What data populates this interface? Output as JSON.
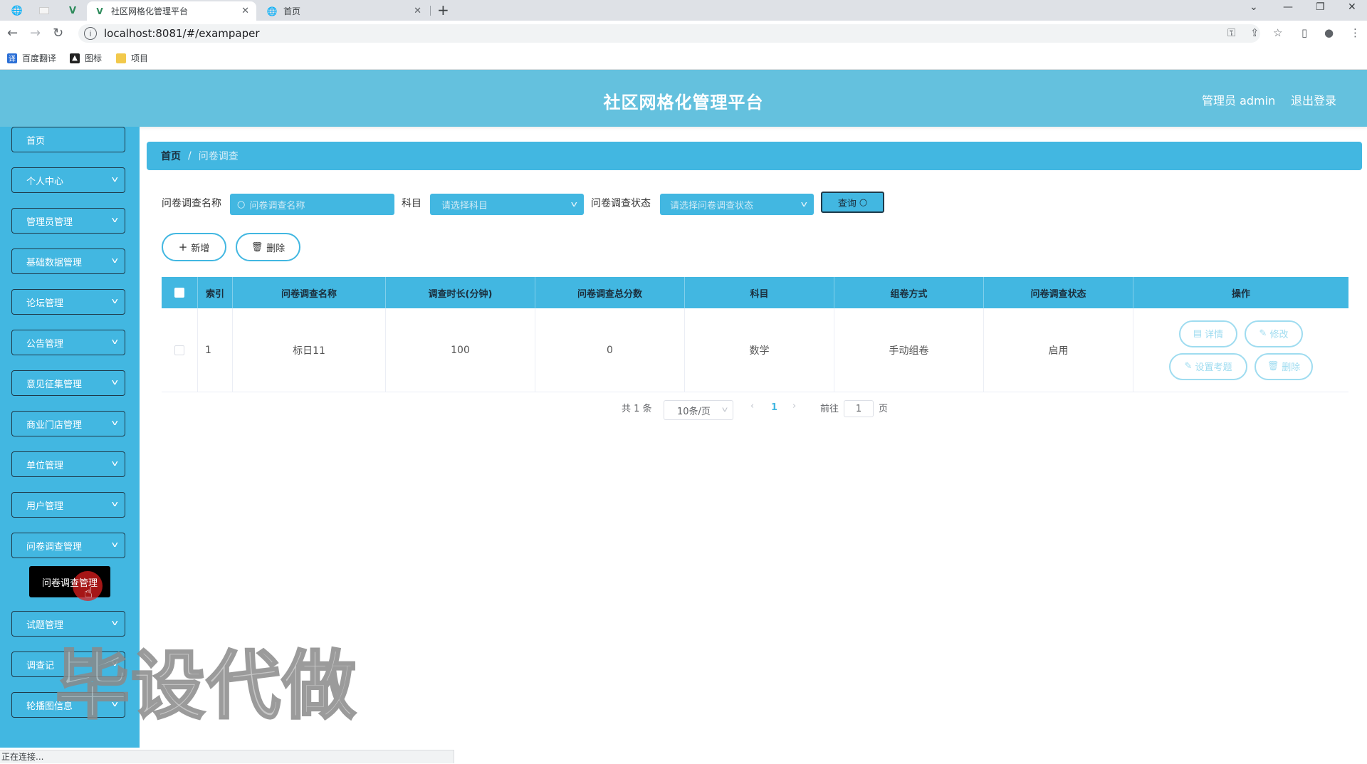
{
  "browser": {
    "tabs": [
      {
        "title": "社区网格化管理平台",
        "active": true
      },
      {
        "title": "首页",
        "active": false
      }
    ],
    "url": "localhost:8081/#/exampaper",
    "bookmarks": [
      "百度翻译",
      "图标",
      "项目"
    ],
    "status_text": "正在连接..."
  },
  "header": {
    "title": "社区网格化管理平台",
    "user": "管理员 admin",
    "logout": "退出登录",
    "accent_color": "#64c1de"
  },
  "sidebar": {
    "items": [
      {
        "label": "首页",
        "has_chevron": false
      },
      {
        "label": "个人中心",
        "has_chevron": true
      },
      {
        "label": "管理员管理",
        "has_chevron": true
      },
      {
        "label": "基础数据管理",
        "has_chevron": true
      },
      {
        "label": "论坛管理",
        "has_chevron": true
      },
      {
        "label": "公告管理",
        "has_chevron": true
      },
      {
        "label": "意见征集管理",
        "has_chevron": true
      },
      {
        "label": "商业门店管理",
        "has_chevron": true
      },
      {
        "label": "单位管理",
        "has_chevron": true
      },
      {
        "label": "用户管理",
        "has_chevron": true
      },
      {
        "label": "问卷调查管理",
        "has_chevron": true
      },
      {
        "label": "试题管理",
        "has_chevron": true
      },
      {
        "label": "调查记",
        "has_chevron": true
      },
      {
        "label": "轮播图信息",
        "has_chevron": true
      }
    ],
    "submenu_popup": "问卷调查管理",
    "color": "#42b7e1"
  },
  "breadcrumb": {
    "home": "首页",
    "separator": "/",
    "current": "问卷调查"
  },
  "filters": {
    "name_label": "问卷调查名称",
    "name_placeholder": "问卷调查名称",
    "subject_label": "科目",
    "subject_placeholder": "请选择科目",
    "status_label": "问卷调查状态",
    "status_placeholder": "请选择问卷调查状态",
    "query_button": "查询"
  },
  "actions": {
    "add": "新增",
    "delete": "删除"
  },
  "table": {
    "columns": [
      "索引",
      "问卷调查名称",
      "调查时长(分钟)",
      "问卷调查总分数",
      "科目",
      "组卷方式",
      "问卷调查状态",
      "操作"
    ],
    "rows": [
      {
        "index": "1",
        "name": "标日11",
        "duration": "100",
        "total_score": "0",
        "subject": "数学",
        "method": "手动组卷",
        "status": "启用"
      }
    ],
    "row_actions": [
      "详情",
      "修改",
      "设置考题",
      "删除"
    ]
  },
  "pagination": {
    "total": "共 1 条",
    "page_size": "10条/页",
    "current_page": "1",
    "goto_label": "前往",
    "goto_value": "1",
    "page_unit": "页"
  },
  "watermark": "毕设代做"
}
